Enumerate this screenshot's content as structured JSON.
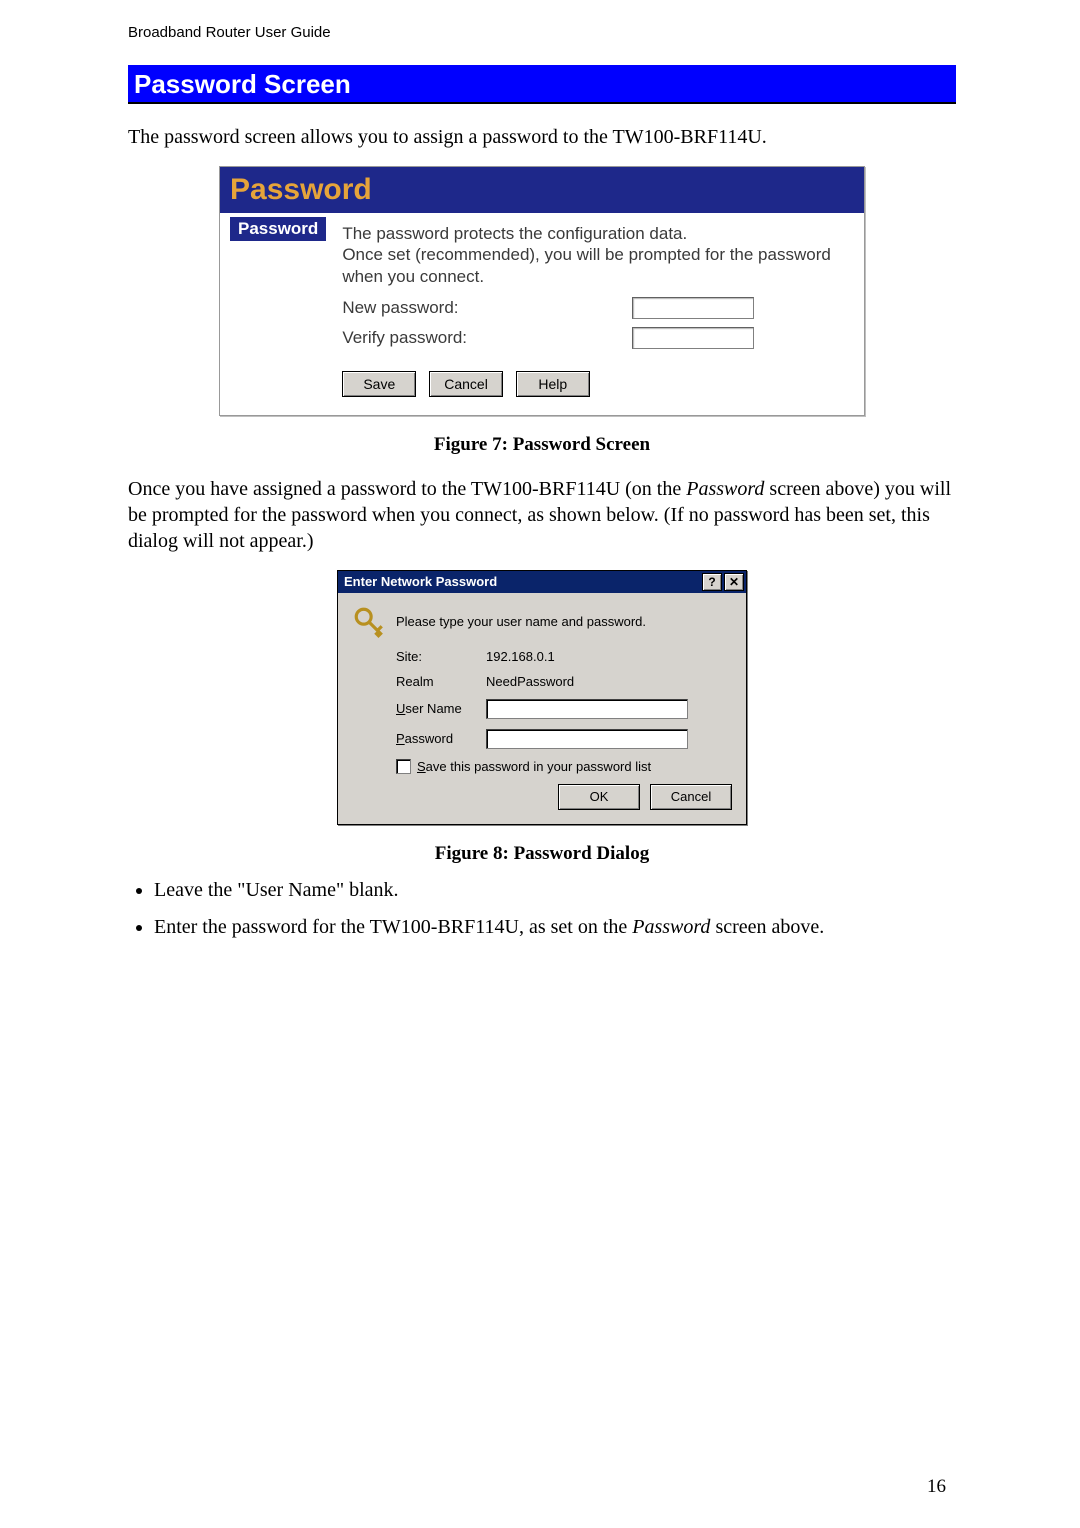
{
  "breadcrumb": "Broadband Router User Guide",
  "section_heading": "Password Screen",
  "intro": "The password screen allows you to assign a password to the TW100-BRF114U.",
  "password_panel": {
    "title": "Password",
    "side_label": "Password",
    "desc": "The password protects the configuration data.\nOnce set (recommended), you will be prompted for the password when you connect.",
    "new_pw": "New password:",
    "verify_pw": "Verify password:",
    "save": "Save",
    "cancel": "Cancel",
    "help": "Help"
  },
  "caption1": "Figure 7: Password Screen",
  "mid_para": "Once you have assigned a password to the TW100-BRF114U (on the Password screen above) you will be prompted for the password when you connect, as shown below. (If no password has been set, this dialog will not appear.)",
  "dialog": {
    "title": "Enter Network Password",
    "prompt": "Please type your user name and password.",
    "site_lbl": "Site:",
    "site_val": "192.168.0.1",
    "realm_lbl": "Realm",
    "realm_val": "NeedPassword",
    "user_lbl": "User Name",
    "pass_lbl": "Password",
    "save_lbl": "Save this password in your password list",
    "ok": "OK",
    "cancel": "Cancel",
    "help_glyph": "?",
    "close_glyph": "✕"
  },
  "caption2": "Figure 8: Password Dialog",
  "bullets": {
    "b1": "Leave the \"User Name\" blank.",
    "b2_pre": "Enter the password for the TW100-BRF114U, as set on the ",
    "b2_it": "Password",
    "b2_post": " screen above."
  },
  "page_number": "16"
}
